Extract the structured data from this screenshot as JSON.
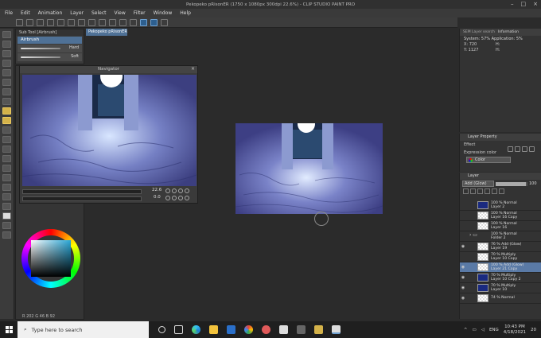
{
  "window": {
    "title": "Pekopeko pRisonER (1750 x 1080px 300dpi 22.6%) - CLIP STUDIO PAINT PRO"
  },
  "menu": [
    "File",
    "Edit",
    "Animation",
    "Layer",
    "Select",
    "View",
    "Filter",
    "Window",
    "Help"
  ],
  "document_tab": "Pekopeko pRisonER",
  "subtool": {
    "header": "Sub Tool [Airbrush]",
    "active": "Airbrush",
    "brushes": [
      "Hard",
      "Soft"
    ]
  },
  "navigator": {
    "title": "Navigator",
    "zoom": "22.6",
    "rotation": "0.0"
  },
  "info_panel": {
    "tabs": [
      "SEM Layer search",
      "Information"
    ],
    "system_label": "System: 57%",
    "application_label": "Application: 5%",
    "x_label": "X: 720",
    "y_label": "Y: 1127"
  },
  "layer_property": {
    "title": "Layer Property",
    "effect_label": "Effect",
    "expression_label": "Expression color",
    "color_value": "Color"
  },
  "layers_panel": {
    "title": "Layer",
    "blend_mode": "Add (Glow)",
    "opacity": "100",
    "layers": [
      {
        "line1": "100 % Normal",
        "line2": "Layer 2",
        "visible": false,
        "thumb": "dark",
        "selected": false
      },
      {
        "line1": "100 % Normal",
        "line2": "Layer 16 Copy",
        "visible": false,
        "thumb": "light",
        "selected": false
      },
      {
        "line1": "100 % Normal",
        "line2": "Layer 16",
        "visible": false,
        "thumb": "light",
        "selected": false
      },
      {
        "line1": "100 % Normal",
        "line2": "Folder 2",
        "visible": false,
        "thumb": "folder",
        "selected": false
      },
      {
        "line1": "76 % Add (Glow)",
        "line2": "Layer 19",
        "visible": true,
        "thumb": "light",
        "selected": false
      },
      {
        "line1": "70 % Multiply",
        "line2": "Layer 10 Copy",
        "visible": false,
        "thumb": "light",
        "selected": false
      },
      {
        "line1": "100 % Add (Glow)",
        "line2": "Layer 21 Copy",
        "visible": true,
        "thumb": "light",
        "selected": true
      },
      {
        "line1": "70 % Multiply",
        "line2": "Layer 10 Copy 2",
        "visible": true,
        "thumb": "dark",
        "selected": false
      },
      {
        "line1": "70 % Multiply",
        "line2": "Layer 10",
        "visible": true,
        "thumb": "dark",
        "selected": false
      },
      {
        "line1": "74 % Normal",
        "line2": "",
        "visible": true,
        "thumb": "light",
        "selected": false
      }
    ]
  },
  "color_readout": "R 202  G 46  B 92",
  "taskbar": {
    "search_placeholder": "Type here to search",
    "language": "ENG",
    "time": "10:43 PM",
    "date": "4/18/2021",
    "notification_count": "20"
  },
  "colors": {
    "accent": "#4f7196",
    "selected_layer": "#5a7aa6"
  }
}
